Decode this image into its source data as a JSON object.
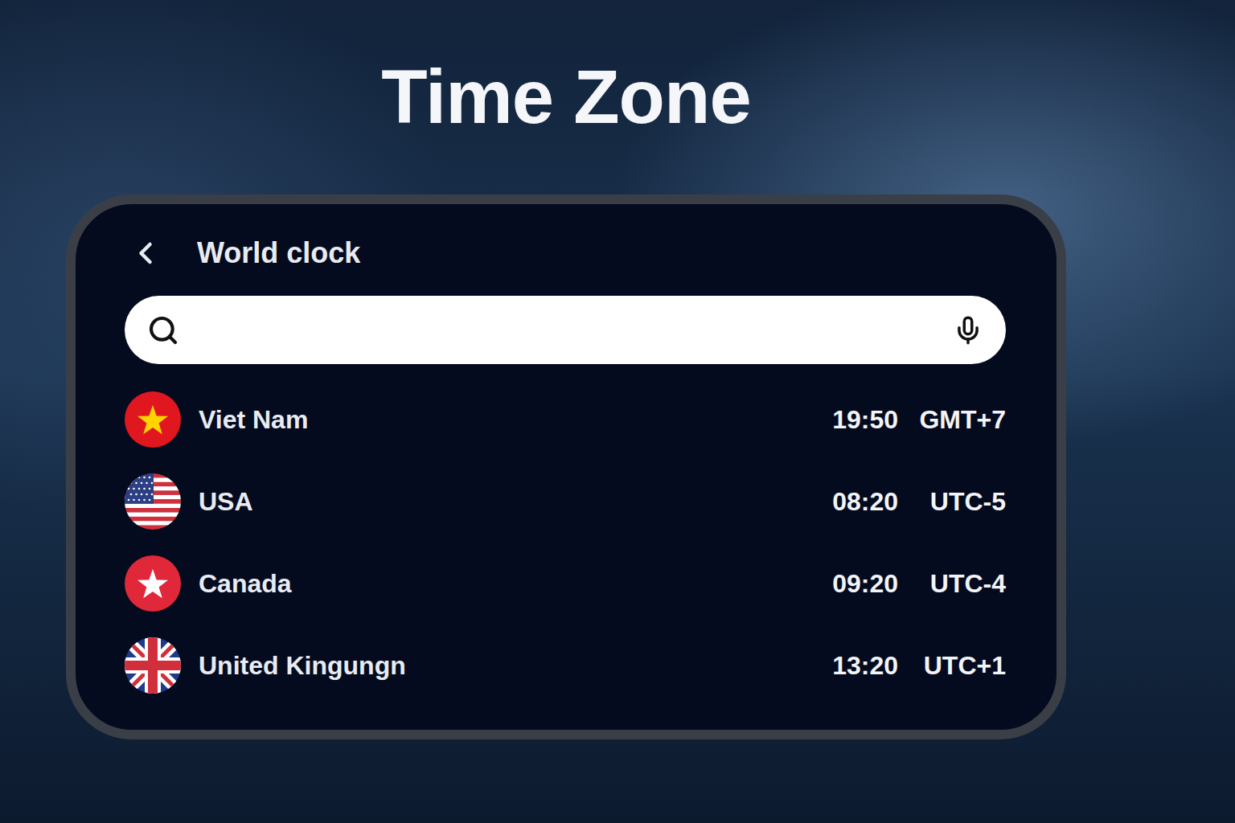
{
  "page": {
    "title": "Time Zone"
  },
  "window": {
    "title": "World clock"
  },
  "search": {
    "placeholder": ""
  },
  "clocks": [
    {
      "country": "Viet Nam",
      "time": "19:50",
      "zone": "GMT+7",
      "kind": "vn"
    },
    {
      "country": "USA",
      "time": "08:20",
      "zone": "UTC-5",
      "kind": "us"
    },
    {
      "country": "Canada",
      "time": "09:20",
      "zone": "UTC-4",
      "kind": "ca"
    },
    {
      "country": "United Kingungn",
      "time": "13:20",
      "zone": "UTC+1",
      "kind": "gb"
    }
  ]
}
